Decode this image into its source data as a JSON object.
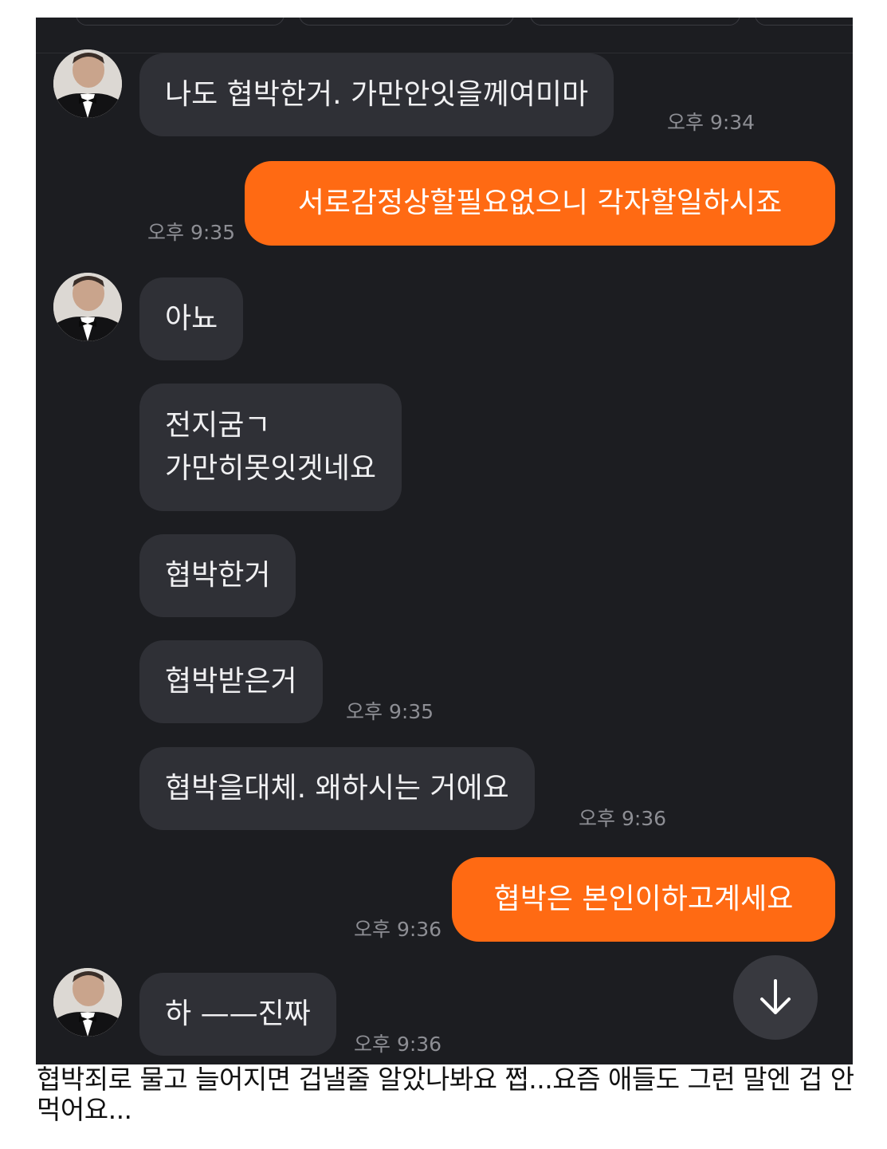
{
  "chat": {
    "messages": [
      {
        "direction": "in",
        "lines": [
          "나도 협박한거. 가만안잇을께여미마"
        ],
        "time": "오후 9:34"
      },
      {
        "direction": "out",
        "lines": [
          "서로감정상할필요없으니 각자할일하시죠"
        ],
        "time": "오후 9:35"
      },
      {
        "direction": "in",
        "lines": [
          "아뇨"
        ],
        "time": ""
      },
      {
        "direction": "in",
        "lines": [
          "전지굼ㄱ",
          "가만히못잇겟네요"
        ],
        "time": ""
      },
      {
        "direction": "in",
        "lines": [
          "협박한거"
        ],
        "time": ""
      },
      {
        "direction": "in",
        "lines": [
          "협박받은거"
        ],
        "time": "오후 9:35"
      },
      {
        "direction": "in",
        "lines": [
          "협박을대체. 왜하시는 거에요"
        ],
        "time": "오후 9:36"
      },
      {
        "direction": "out",
        "lines": [
          "협박은 본인이하고계세요"
        ],
        "time": "오후 9:36"
      },
      {
        "direction": "in",
        "lines": [
          "하 ——진짜"
        ],
        "time": "오후 9:36"
      }
    ],
    "scroll_button_icon": "arrow-down-icon",
    "colors": {
      "background": "#1c1d21",
      "incoming_bubble": "#2f3036",
      "outgoing_bubble": "#ff6a13",
      "timestamp": "#8d8e94"
    }
  },
  "caption": "협박죄로 물고 늘어지면 겁낼줄 알았나봐요 쩝...요즘 애들도 그런 말엔 겁 안먹어요..."
}
